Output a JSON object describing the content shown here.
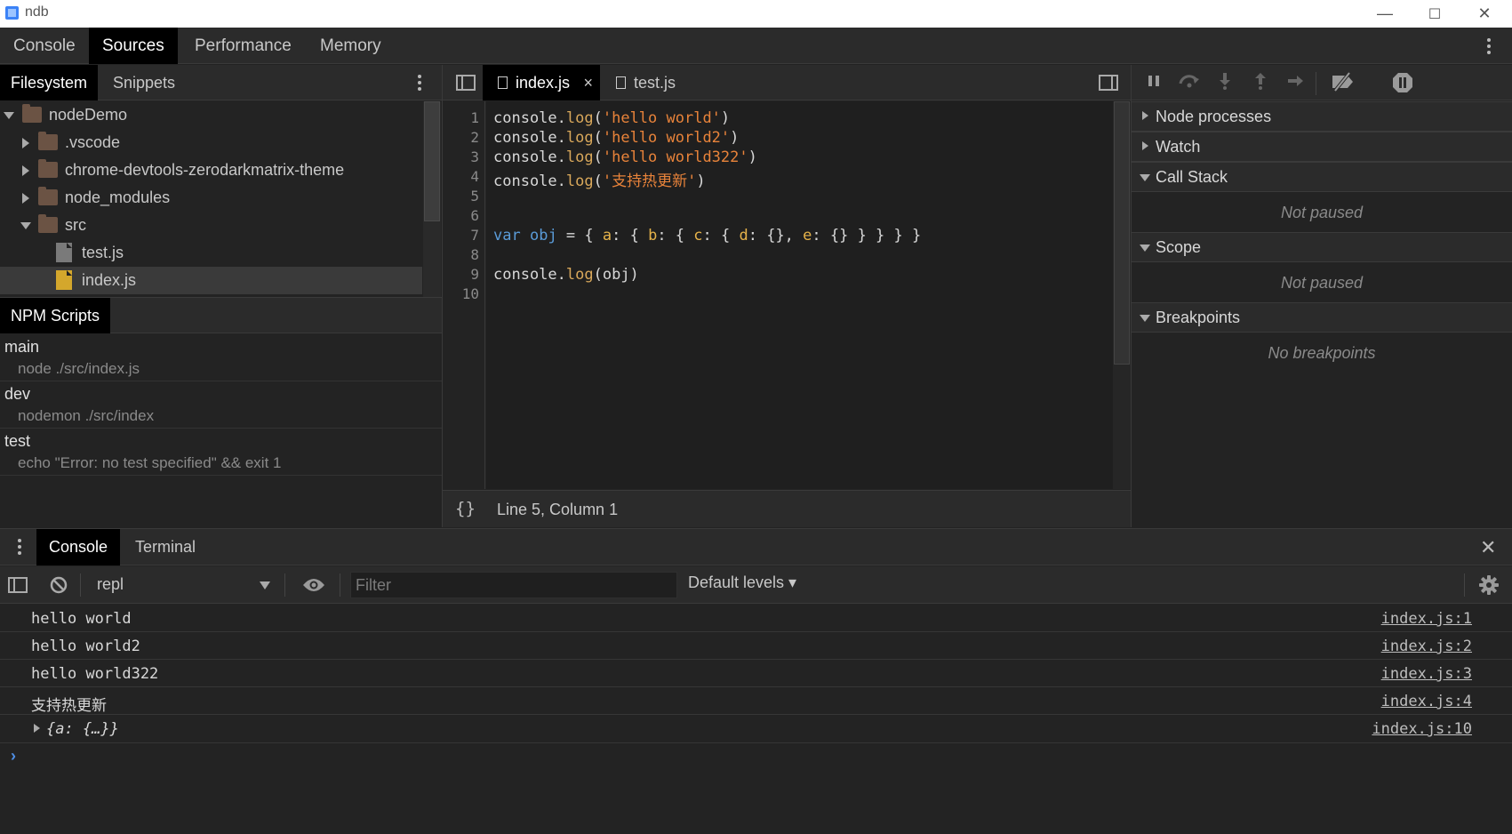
{
  "window": {
    "title": "ndb",
    "min": "—",
    "max": "☐",
    "close": "✕"
  },
  "main_tabs": [
    "Console",
    "Sources",
    "Performance",
    "Memory"
  ],
  "navigator": {
    "tabs": [
      "Filesystem",
      "Snippets"
    ],
    "tree": [
      {
        "label": "nodeDemo",
        "kind": "folder",
        "expanded": true
      },
      {
        "label": ".vscode",
        "kind": "folder",
        "expanded": false
      },
      {
        "label": "chrome-devtools-zerodarkmatrix-theme",
        "kind": "folder",
        "expanded": false
      },
      {
        "label": "node_modules",
        "kind": "folder",
        "expanded": false
      },
      {
        "label": "src",
        "kind": "folder",
        "expanded": true
      },
      {
        "label": "test.js",
        "kind": "file"
      },
      {
        "label": "index.js",
        "kind": "file",
        "selected": true
      }
    ]
  },
  "npm": {
    "title": "NPM Scripts",
    "scripts": [
      {
        "name": "main",
        "command": "node ./src/index.js"
      },
      {
        "name": "dev",
        "command": "nodemon ./src/index"
      },
      {
        "name": "test",
        "command": "echo \"Error: no test specified\" && exit 1"
      }
    ]
  },
  "editor": {
    "tabs": [
      {
        "label": "index.js",
        "active": true,
        "close": "×"
      },
      {
        "label": "test.js",
        "active": false
      }
    ],
    "line_numbers": [
      "1",
      "2",
      "3",
      "4",
      "5",
      "6",
      "7",
      "8",
      "9",
      "10"
    ],
    "code": {
      "l1": {
        "a": "console.",
        "b": "log",
        "c": "(",
        "d": "'hello world'",
        "e": ")"
      },
      "l2": {
        "a": "console.",
        "b": "log",
        "c": "(",
        "d": "'hello world2'",
        "e": ")"
      },
      "l3": {
        "a": "console.",
        "b": "log",
        "c": "(",
        "d": "'hello world322'",
        "e": ")"
      },
      "l4": {
        "a": "console.",
        "b": "log",
        "c": "(",
        "d": "'支持热更新'",
        "e": ")"
      },
      "l7": {
        "kw": "var",
        "name": "obj",
        "eq": " = { ",
        "a": "a",
        "p1": ": { ",
        "b": "b",
        "p2": ": { ",
        "c": "c",
        "p3": ": { ",
        "d": "d",
        "p4": ": {}, ",
        "e": "e",
        "p5": ": {} } } } }"
      },
      "l9": {
        "a": "console.",
        "b": "log",
        "c": "(obj)"
      }
    },
    "status": {
      "braces": "{}",
      "position": "Line 5, Column 1"
    }
  },
  "debugger": {
    "sections": [
      {
        "label": "Node processes",
        "expanded": false
      },
      {
        "label": "Watch",
        "expanded": false
      },
      {
        "label": "Call Stack",
        "expanded": true,
        "body": "Not paused"
      },
      {
        "label": "Scope",
        "expanded": true,
        "body": "Not paused"
      },
      {
        "label": "Breakpoints",
        "expanded": true,
        "body": "No breakpoints"
      }
    ]
  },
  "drawer": {
    "tabs": [
      "Console",
      "Terminal"
    ],
    "close": "✕",
    "context": "repl",
    "filter_placeholder": "Filter",
    "levels": "Default levels ▾",
    "messages": [
      {
        "text": "hello world",
        "source": "index.js:1"
      },
      {
        "text": "hello world2",
        "source": "index.js:2"
      },
      {
        "text": "hello world322",
        "source": "index.js:3"
      },
      {
        "text": "支持热更新",
        "source": "index.js:4"
      },
      {
        "text": "{a: {…}}",
        "source": "index.js:10",
        "expandable": true
      }
    ],
    "prompt": "›"
  },
  "colors": {
    "accent": "#4f8fe6",
    "string": "#e8833a",
    "keyword": "#5a9bd8",
    "js_file": "#d4a72c",
    "folder": "#6b5344"
  }
}
